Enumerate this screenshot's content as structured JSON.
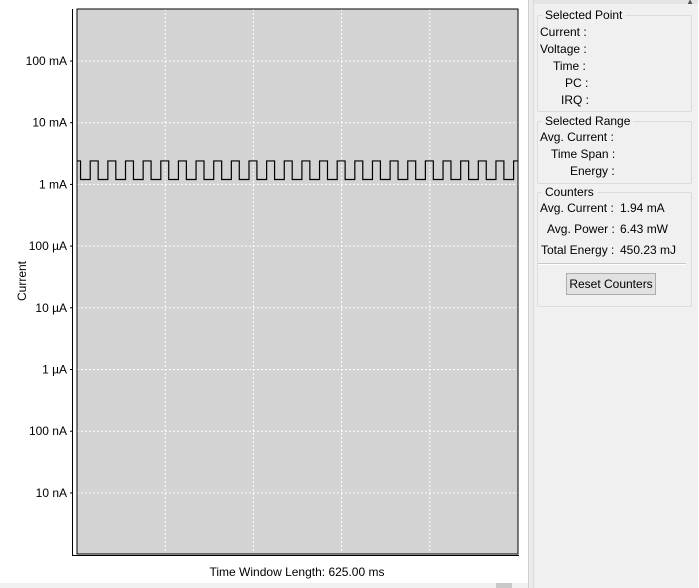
{
  "plot": {
    "footer_label": "Time Window Length: 625.00 ms"
  },
  "chart_data": {
    "type": "line",
    "ylabel": "Current",
    "xlabel": "Time Window Length: 625.00 ms",
    "y_scale": "log",
    "y_ticks": [
      {
        "value": 1e-07,
        "label": "100 mA"
      },
      {
        "value": 0.01,
        "label": "10 mA"
      },
      {
        "value": 0.001,
        "label": "1 mA"
      },
      {
        "value": 0.0001,
        "label": "100 µA"
      },
      {
        "value": 1e-05,
        "label": "10 µA"
      },
      {
        "value": 1e-06,
        "label": "1 µA"
      },
      {
        "value": 1e-07,
        "label": "100 nA"
      },
      {
        "value": 1e-08,
        "label": "10 nA"
      }
    ],
    "ylim": [
      1e-09,
      1
    ],
    "grid": true,
    "x_gridlines": 5,
    "plot_background": "#d3d3d3",
    "signal": {
      "description_type": "square-wave",
      "high_current_ma": 2.4,
      "low_current_ma": 1.2,
      "periods": 25
    }
  },
  "side_panel": {
    "selected_point": {
      "title": "Selected Point",
      "rows": [
        {
          "label": "Current :",
          "value": ""
        },
        {
          "label": "Voltage :",
          "value": ""
        },
        {
          "label": "Time :",
          "value": ""
        },
        {
          "label": "PC :",
          "value": ""
        },
        {
          "label": "IRQ :",
          "value": ""
        }
      ]
    },
    "selected_range": {
      "title": "Selected Range",
      "rows": [
        {
          "label": "Avg. Current :",
          "value": ""
        },
        {
          "label": "Time Span :",
          "value": ""
        },
        {
          "label": "Energy :",
          "value": ""
        }
      ]
    },
    "counters": {
      "title": "Counters",
      "rows": [
        {
          "label": "Avg. Current :",
          "value": "1.94 mA"
        },
        {
          "label": "Avg. Power :",
          "value": "6.43 mW"
        },
        {
          "label": "Total Energy :",
          "value": "450.23 mJ"
        }
      ],
      "reset_label": "Reset Counters"
    }
  }
}
